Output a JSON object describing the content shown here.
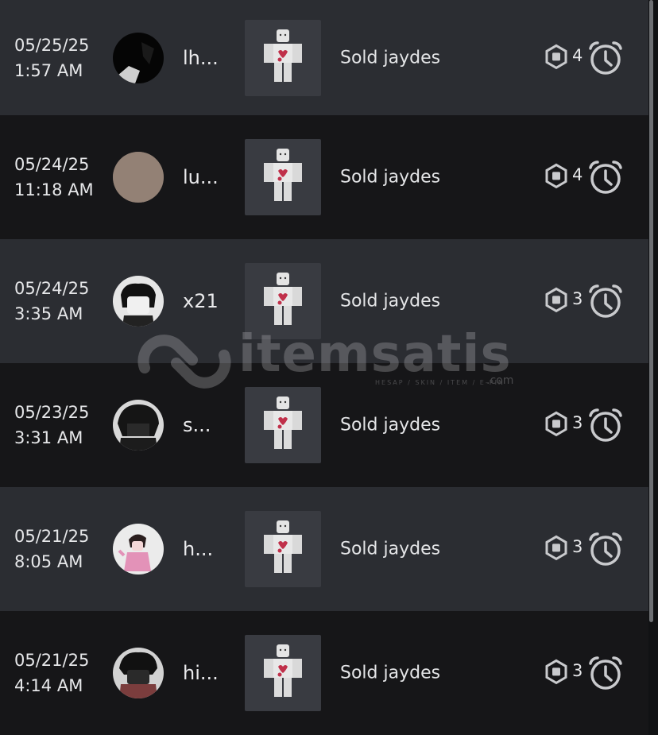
{
  "transactions": [
    {
      "date": "05/25/25",
      "time": "1:57 AM",
      "user": "lh...",
      "status": "Sold jaydes",
      "amount": "4"
    },
    {
      "date": "05/24/25",
      "time": "11:18 AM",
      "user": "lu...",
      "status": "Sold jaydes",
      "amount": "4"
    },
    {
      "date": "05/24/25",
      "time": "3:35 AM",
      "user": "x21",
      "status": "Sold jaydes",
      "amount": "3"
    },
    {
      "date": "05/23/25",
      "time": "3:31 AM",
      "user": "s...",
      "status": "Sold jaydes",
      "amount": "3"
    },
    {
      "date": "05/21/25",
      "time": "8:05 AM",
      "user": "h...",
      "status": "Sold jaydes",
      "amount": "3"
    },
    {
      "date": "05/21/25",
      "time": "4:14 AM",
      "user": "hi...",
      "status": "Sold jaydes",
      "amount": "3"
    }
  ],
  "icons": {
    "currency": "robux-icon",
    "pending": "alarm-clock-icon"
  },
  "watermark": {
    "brand": "itemsatis",
    "tagline": "HESAP / SKIN / ITEM / E-PIN",
    "suffix": ".com"
  },
  "colors": {
    "row_light": "#2b2d32",
    "row_dark": "#161618",
    "text": "#e3e4e6",
    "icon": "#c9cacd"
  }
}
